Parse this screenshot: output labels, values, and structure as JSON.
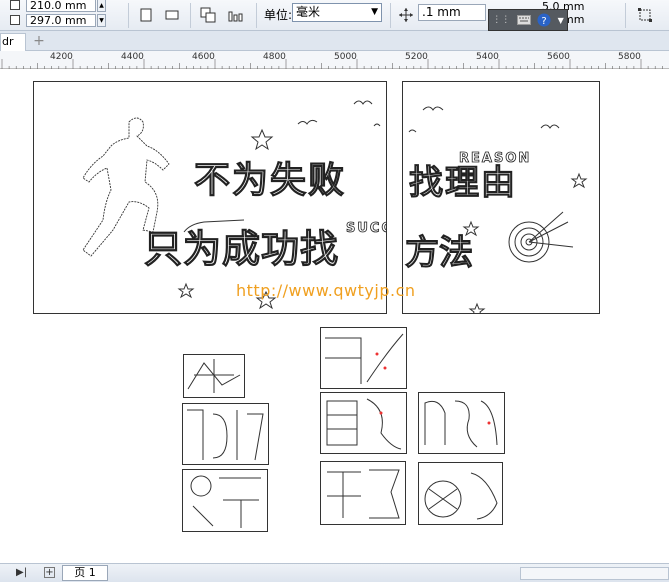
{
  "propbar": {
    "width_value": "210.0 mm",
    "height_value": "297.0 mm",
    "unit_label": "单位:",
    "unit_value": "毫米",
    "nudge_value": ".1 mm",
    "dup_x": "5.0 mm",
    "dup_y": "5.0 mm"
  },
  "tabs": {
    "doc_tab": "dr",
    "add_tab": "+"
  },
  "ruler": {
    "labels": [
      "4200",
      "4400",
      "4600",
      "4800",
      "5000",
      "5200",
      "5400",
      "5600",
      "5800"
    ]
  },
  "design": {
    "line1": "不为失败",
    "line1b": "找理由",
    "line2": "只为成功找",
    "line2b": "方法",
    "reason": "REASON",
    "success": "SUCCESS"
  },
  "watermark": "http://www.qwtyjp.cn",
  "status": {
    "page_tab": "页 1",
    "nav_first": "▶|",
    "nav_add": "+"
  }
}
